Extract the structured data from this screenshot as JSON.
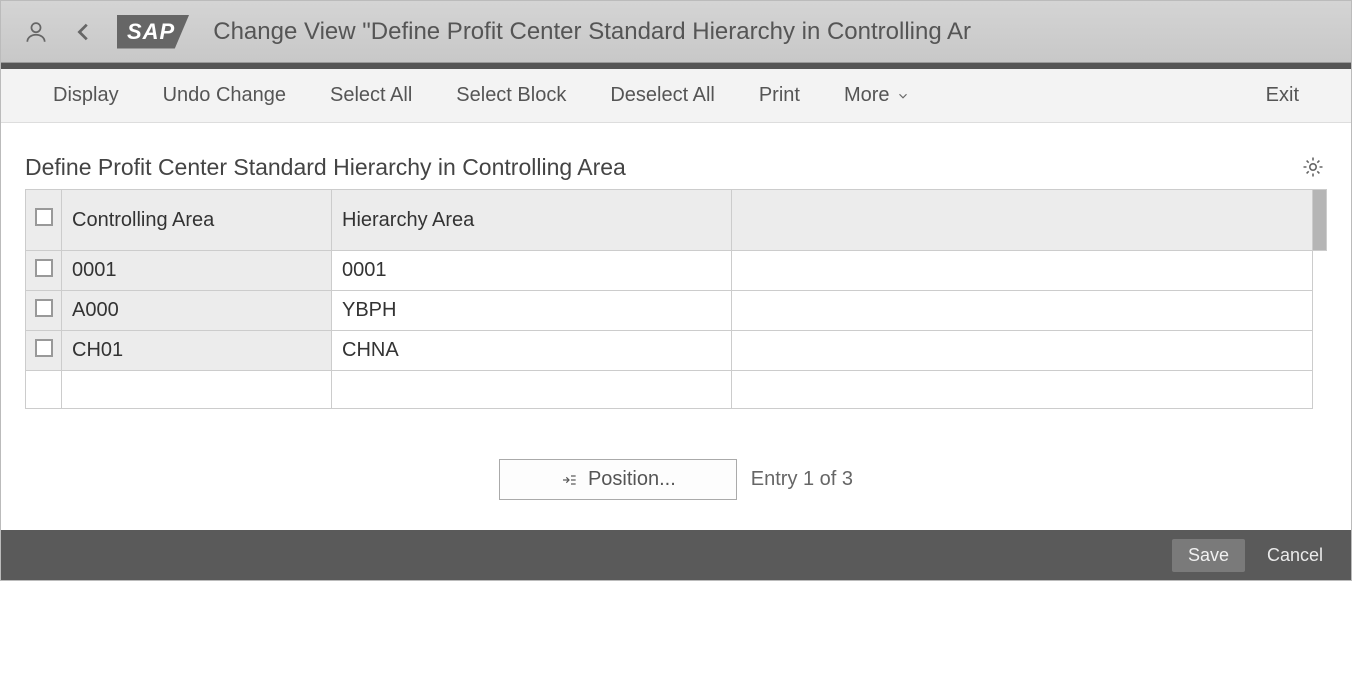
{
  "header": {
    "title": "Change View \"Define Profit Center Standard Hierarchy in Controlling Ar",
    "logo_text": "SAP"
  },
  "toolbar": {
    "display": "Display",
    "undo": "Undo Change",
    "select_all": "Select All",
    "select_block": "Select Block",
    "deselect_all": "Deselect All",
    "print": "Print",
    "more": "More",
    "exit": "Exit"
  },
  "section": {
    "title": "Define Profit Center Standard Hierarchy in Controlling Area"
  },
  "table": {
    "columns": {
      "controlling_area": "Controlling Area",
      "hierarchy_area": "Hierarchy Area"
    },
    "rows": [
      {
        "controlling_area": "0001",
        "hierarchy_area": "0001"
      },
      {
        "controlling_area": "A000",
        "hierarchy_area": "YBPH"
      },
      {
        "controlling_area": "CH01",
        "hierarchy_area": "CHNA"
      }
    ]
  },
  "position": {
    "button": "Position...",
    "status": "Entry 1 of 3"
  },
  "footer": {
    "save": "Save",
    "cancel": "Cancel"
  }
}
